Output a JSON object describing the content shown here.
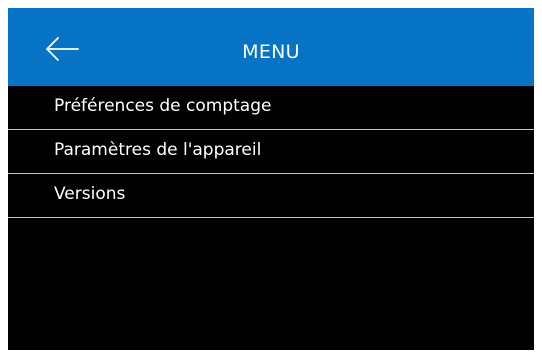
{
  "header": {
    "title": "MENU",
    "back_icon": "arrow-left-icon",
    "background_color": "#0673c4"
  },
  "menu": {
    "items": [
      {
        "label": "Préférences de comptage"
      },
      {
        "label": "Paramètres de l'appareil"
      },
      {
        "label": "Versions"
      }
    ]
  },
  "colors": {
    "screen_background": "#000000",
    "text": "#ffffff",
    "divider": "#c8c8c8"
  }
}
